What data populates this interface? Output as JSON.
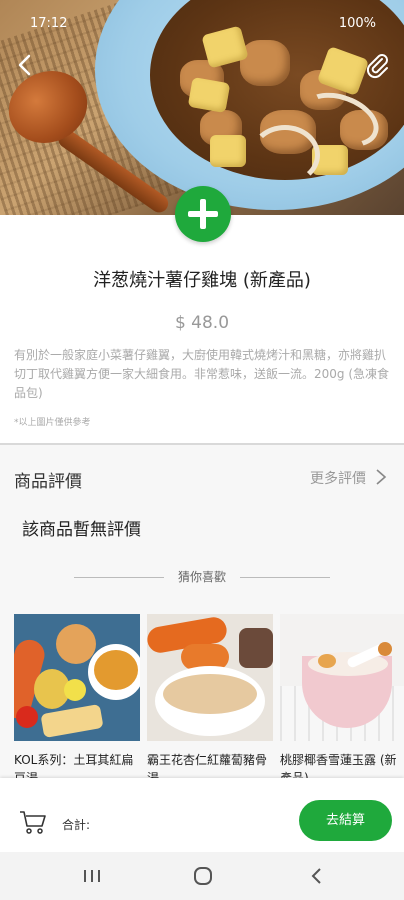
{
  "status_bar": {
    "time": "17:12",
    "battery": "100%"
  },
  "product": {
    "title": "洋葱燒汁薯仔雞塊 (新產品)",
    "price": "$ 48.0",
    "description": "有別於一般家庭小菜薯仔雞翼，大廚使用韓式燒烤汁和黑糖，亦將雞扒切丁取代雞翼方便一家大細食用。非常惹味，送飯一流。200g (急凍食品包)",
    "note": "*以上圖片僅供參考"
  },
  "reviews": {
    "title": "商品評價",
    "more": "更多評價",
    "empty": "該商品暫無評價"
  },
  "recommend": {
    "title": "猜你喜歡",
    "items": [
      {
        "name": "KOL系列：土耳其紅扁豆湯"
      },
      {
        "name": "霸王花杏仁紅蘿蔔豬骨湯"
      },
      {
        "name": "桃膠椰香雪蓮玉露 (新產品)"
      }
    ]
  },
  "cart": {
    "total_label": "合計:",
    "checkout_label": "去結算"
  },
  "colors": {
    "accent": "#1fa93c"
  },
  "icons": [
    "back-arrow-icon",
    "paperclip-icon",
    "plus-icon",
    "chevron-right-icon",
    "cart-icon",
    "recent-apps-icon",
    "home-icon",
    "back-icon"
  ]
}
